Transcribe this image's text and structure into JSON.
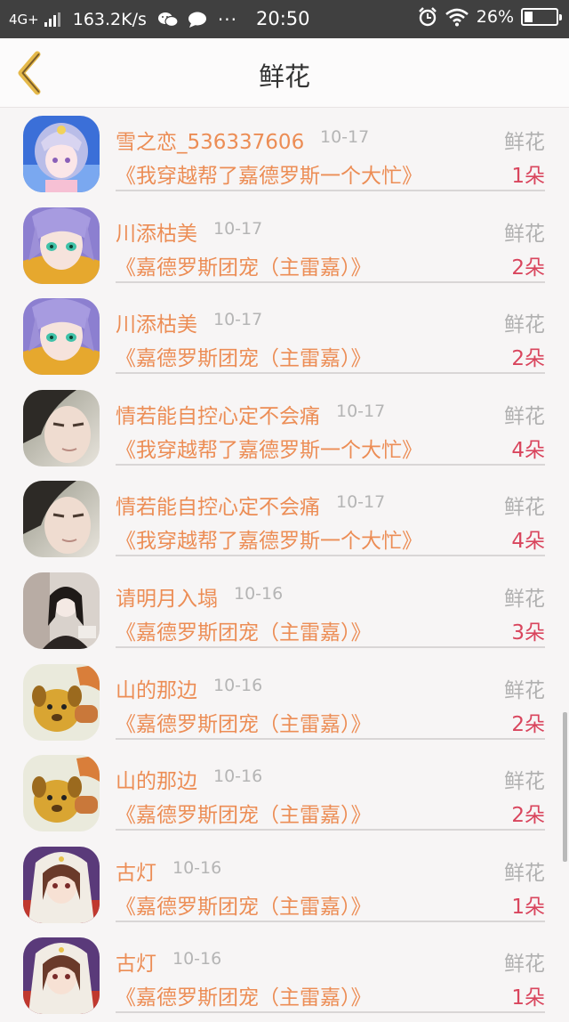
{
  "status_bar": {
    "network": "4G+",
    "speed": "163.2K/s",
    "dots": "···",
    "time": "20:50",
    "battery": "26%",
    "battery_level": 0.26,
    "icons": [
      "signal-icon",
      "wechat-icon",
      "message-icon",
      "alarm-icon",
      "wifi-icon",
      "battery-icon"
    ]
  },
  "navbar": {
    "title": "鲜花",
    "back_icon": "chevron-left-icon",
    "accent_color": "#e5b94a"
  },
  "colors": {
    "name": "#ec8d55",
    "date": "#b5b5b5",
    "label": "#b0b0b0",
    "count": "#d9455d"
  },
  "records": [
    {
      "name": "雪之恋_536337606",
      "date": "10-17",
      "label": "鲜花",
      "book": "《我穿越帮了嘉德罗斯一个大忙》",
      "count": "1朵",
      "avatar": "anime-girl-blue"
    },
    {
      "name": "川添枯美",
      "date": "10-17",
      "label": "鲜花",
      "book": "《嘉德罗斯团宠（主雷嘉）》",
      "count": "2朵",
      "avatar": "anime-boy-purple"
    },
    {
      "name": "川添枯美",
      "date": "10-17",
      "label": "鲜花",
      "book": "《嘉德罗斯团宠（主雷嘉）》",
      "count": "2朵",
      "avatar": "anime-boy-purple"
    },
    {
      "name": "情若能自控心定不会痛",
      "date": "10-17",
      "label": "鲜花",
      "book": "《我穿越帮了嘉德罗斯一个大忙》",
      "count": "4朵",
      "avatar": "photo-face"
    },
    {
      "name": "情若能自控心定不会痛",
      "date": "10-17",
      "label": "鲜花",
      "book": "《我穿越帮了嘉德罗斯一个大忙》",
      "count": "4朵",
      "avatar": "photo-face"
    },
    {
      "name": "请明月入塌",
      "date": "10-16",
      "label": "鲜花",
      "book": "《嘉德罗斯团宠（主雷嘉）》",
      "count": "3朵",
      "avatar": "photo-girl"
    },
    {
      "name": "山的那边",
      "date": "10-16",
      "label": "鲜花",
      "book": "《嘉德罗斯团宠（主雷嘉）》",
      "count": "2朵",
      "avatar": "cartoon-dog"
    },
    {
      "name": "山的那边",
      "date": "10-16",
      "label": "鲜花",
      "book": "《嘉德罗斯团宠（主雷嘉）》",
      "count": "2朵",
      "avatar": "cartoon-dog"
    },
    {
      "name": "古灯",
      "date": "10-16",
      "label": "鲜花",
      "book": "《嘉德罗斯团宠（主雷嘉）》",
      "count": "1朵",
      "avatar": "anime-girl-veil"
    },
    {
      "name": "古灯",
      "date": "10-16",
      "label": "鲜花",
      "book": "《嘉德罗斯团宠（主雷嘉）》",
      "count": "1朵",
      "avatar": "anime-girl-veil"
    }
  ]
}
